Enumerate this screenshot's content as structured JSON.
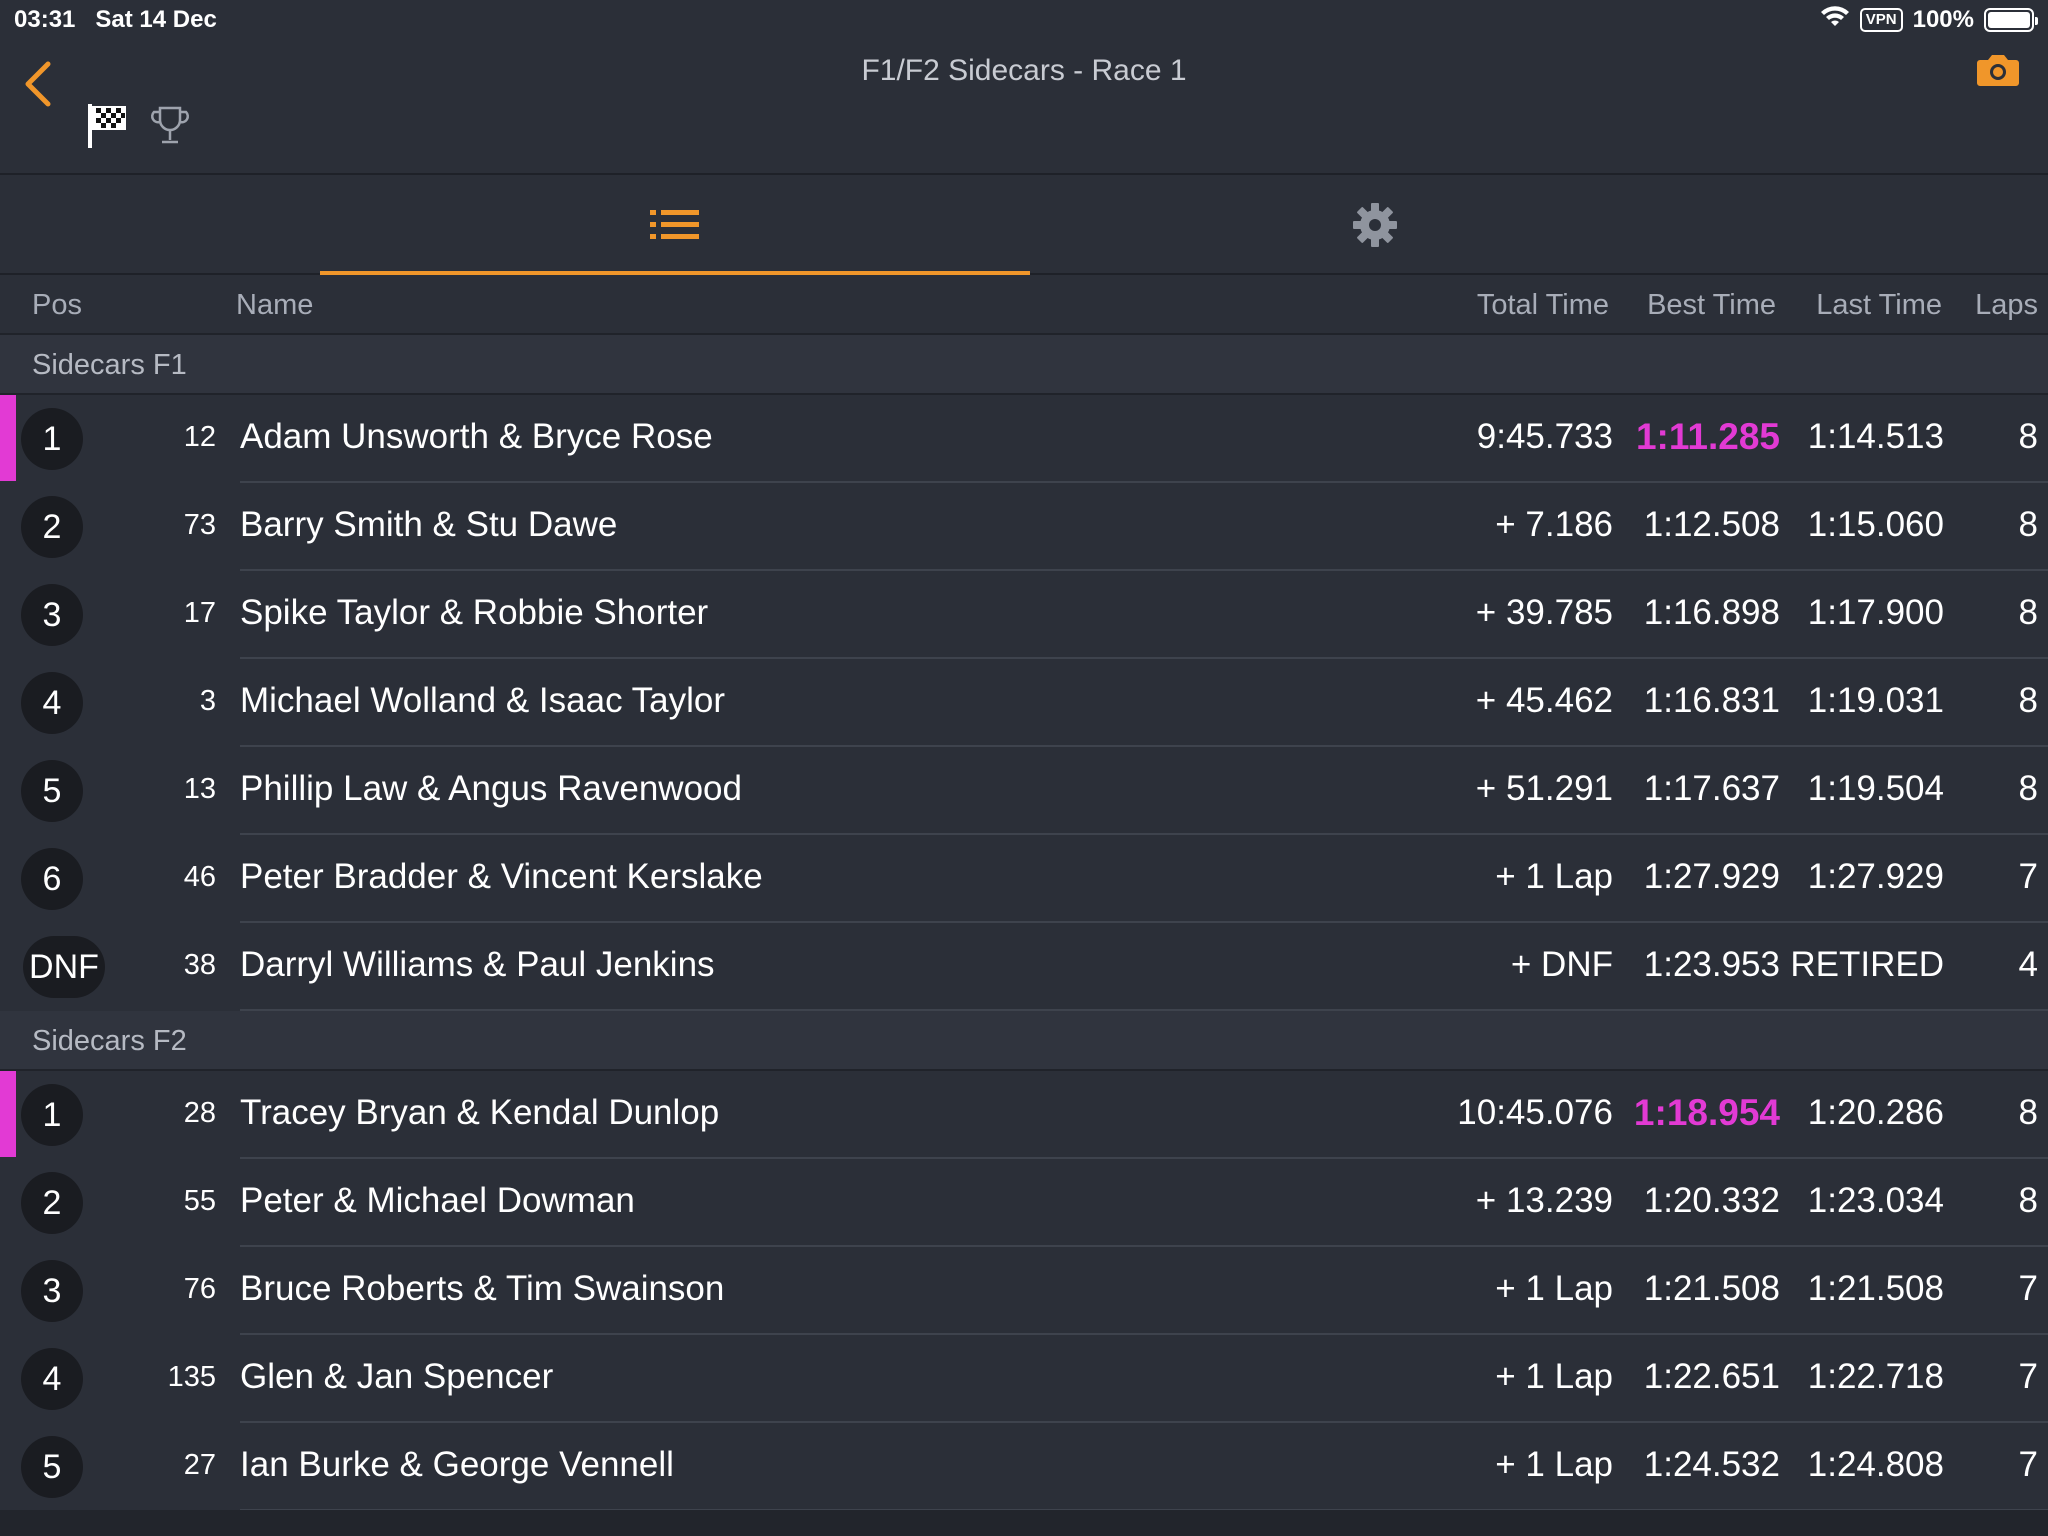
{
  "status_bar": {
    "time": "03:31",
    "date": "Sat 14 Dec",
    "vpn": "VPN",
    "battery": "100%"
  },
  "nav": {
    "title": "F1/F2 Sidecars - Race 1"
  },
  "colors": {
    "accent": "#f0962a",
    "fastest": "#e23ad4",
    "background": "#2b2f38"
  },
  "icons": {
    "back": "chevron-left-icon",
    "flag": "checkered-flag-icon",
    "trophy": "trophy-icon",
    "camera": "camera-icon",
    "list": "list-icon",
    "settings": "gear-icon"
  },
  "columns": {
    "pos": "Pos",
    "name": "Name",
    "total": "Total Time",
    "best": "Best Time",
    "last": "Last Time",
    "laps": "Laps"
  },
  "groups": [
    {
      "title": "Sidecars F1",
      "rows": [
        {
          "pos": "1",
          "num": "12",
          "name": "Adam Unsworth & Bryce Rose",
          "total": "9:45.733",
          "best": "1:11.285",
          "last": "1:14.513",
          "laps": "8",
          "fastest": true
        },
        {
          "pos": "2",
          "num": "73",
          "name": "Barry Smith & Stu Dawe",
          "total": "+ 7.186",
          "best": "1:12.508",
          "last": "1:15.060",
          "laps": "8",
          "fastest": false
        },
        {
          "pos": "3",
          "num": "17",
          "name": "Spike Taylor & Robbie Shorter",
          "total": "+ 39.785",
          "best": "1:16.898",
          "last": "1:17.900",
          "laps": "8",
          "fastest": false
        },
        {
          "pos": "4",
          "num": "3",
          "name": "Michael Wolland & Isaac Taylor",
          "total": "+ 45.462",
          "best": "1:16.831",
          "last": "1:19.031",
          "laps": "8",
          "fastest": false
        },
        {
          "pos": "5",
          "num": "13",
          "name": "Phillip Law & Angus Ravenwood",
          "total": "+ 51.291",
          "best": "1:17.637",
          "last": "1:19.504",
          "laps": "8",
          "fastest": false
        },
        {
          "pos": "6",
          "num": "46",
          "name": "Peter Bradder & Vincent Kerslake",
          "total": "+ 1 Lap",
          "best": "1:27.929",
          "last": "1:27.929",
          "laps": "7",
          "fastest": false
        },
        {
          "pos": "DNF",
          "num": "38",
          "name": "Darryl Williams & Paul Jenkins",
          "total": "+ DNF",
          "best": "1:23.953",
          "last": "RETIRED",
          "laps": "4",
          "fastest": false
        }
      ]
    },
    {
      "title": "Sidecars F2",
      "rows": [
        {
          "pos": "1",
          "num": "28",
          "name": "Tracey Bryan & Kendal Dunlop",
          "total": "10:45.076",
          "best": "1:18.954",
          "last": "1:20.286",
          "laps": "8",
          "fastest": true
        },
        {
          "pos": "2",
          "num": "55",
          "name": "Peter & Michael Dowman",
          "total": "+ 13.239",
          "best": "1:20.332",
          "last": "1:23.034",
          "laps": "8",
          "fastest": false
        },
        {
          "pos": "3",
          "num": "76",
          "name": "Bruce Roberts & Tim Swainson",
          "total": "+ 1 Lap",
          "best": "1:21.508",
          "last": "1:21.508",
          "laps": "7",
          "fastest": false
        },
        {
          "pos": "4",
          "num": "135",
          "name": "Glen & Jan Spencer",
          "total": "+ 1 Lap",
          "best": "1:22.651",
          "last": "1:22.718",
          "laps": "7",
          "fastest": false
        },
        {
          "pos": "5",
          "num": "27",
          "name": "Ian Burke & George Vennell",
          "total": "+ 1 Lap",
          "best": "1:24.532",
          "last": "1:24.808",
          "laps": "7",
          "fastest": false
        }
      ]
    }
  ]
}
